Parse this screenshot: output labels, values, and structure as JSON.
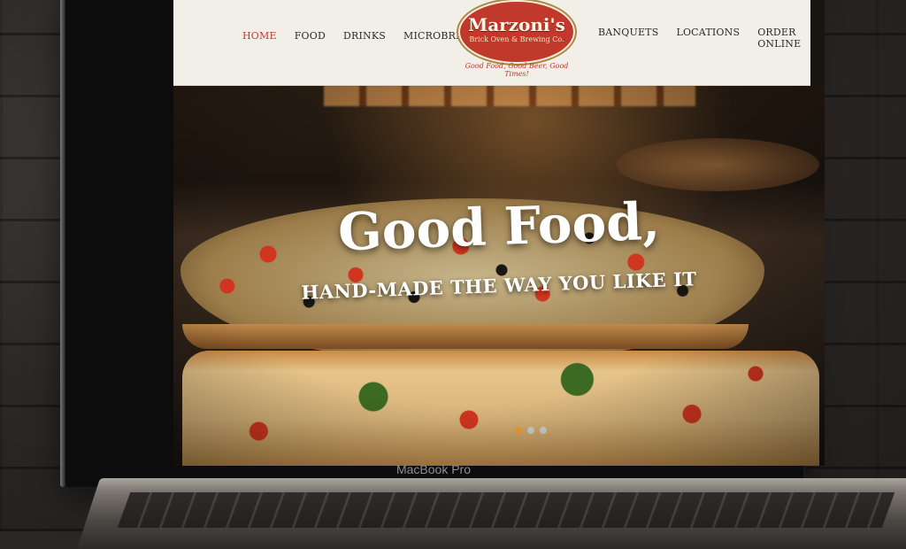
{
  "nav": {
    "left": [
      {
        "label": "HOME",
        "active": true
      },
      {
        "label": "FOOD",
        "active": false
      },
      {
        "label": "DRINKS",
        "active": false
      },
      {
        "label": "MICROBREWERY",
        "active": false
      }
    ],
    "right": [
      {
        "label": "BANQUETS"
      },
      {
        "label": "LOCATIONS"
      },
      {
        "label": "ORDER ONLINE"
      }
    ]
  },
  "logo": {
    "name": "Marzoni's",
    "subtitle": "Brick Oven & Brewing Co.",
    "tagline": "Good Food, Good Beer, Good Times!"
  },
  "hero": {
    "title": "Good Food,",
    "subtitle": "HAND-MADE THE WAY YOU LIKE IT",
    "slides": 3,
    "active_slide": 1
  },
  "device": {
    "label": "MacBook Pro"
  },
  "colors": {
    "accent": "#c0392b",
    "nav_bg": "#f2efe8",
    "active_dot": "#f0a030"
  }
}
